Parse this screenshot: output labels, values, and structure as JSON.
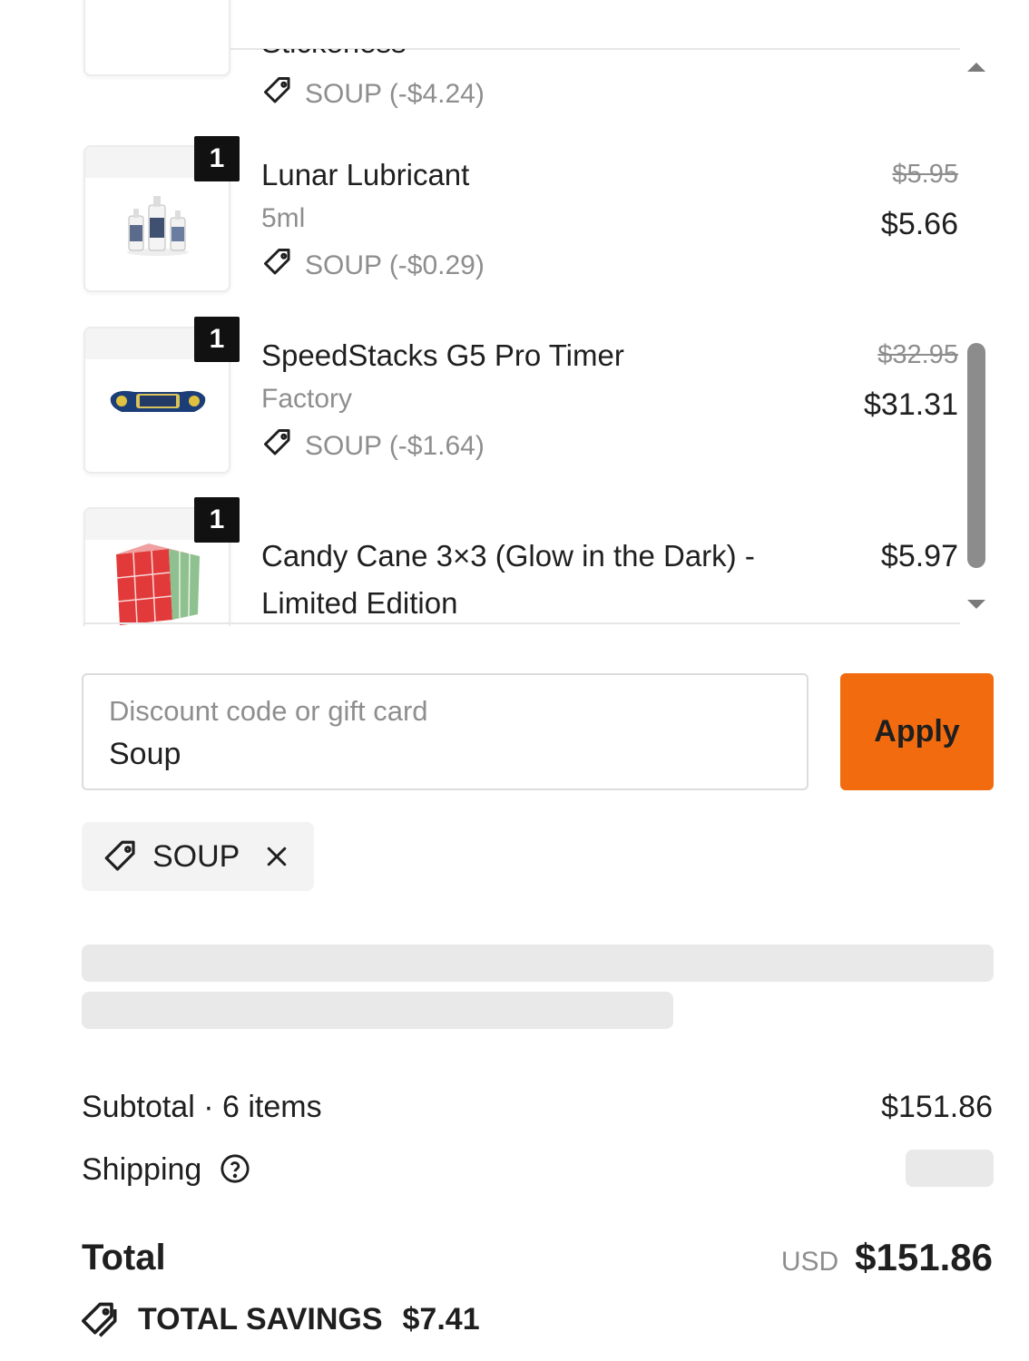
{
  "cart": {
    "items": [
      {
        "name": "Stickerless",
        "discount": "SOUP (-$4.24)"
      },
      {
        "quantity": "1",
        "name": "Lunar Lubricant",
        "variant": "5ml",
        "discount": "SOUP (-$0.29)",
        "original_price": "$5.95",
        "price": "$5.66"
      },
      {
        "quantity": "1",
        "name": "SpeedStacks G5 Pro Timer",
        "variant": "Factory",
        "discount": "SOUP (-$1.64)",
        "original_price": "$32.95",
        "price": "$31.31"
      },
      {
        "quantity": "1",
        "name_line1": "Candy Cane 3×3 (Glow in the Dark) -",
        "name_line2": "Limited Edition",
        "price": "$5.97"
      }
    ]
  },
  "discount": {
    "label": "Discount code or gift card",
    "value": "Soup",
    "apply_label": "Apply",
    "applied_code": "SOUP"
  },
  "summary": {
    "subtotal_label": "Subtotal · 6 items",
    "subtotal_value": "$151.86",
    "shipping_label": "Shipping",
    "total_label": "Total",
    "currency": "USD",
    "total_value": "$151.86",
    "savings_label": "TOTAL SAVINGS",
    "savings_value": "$7.41"
  },
  "colors": {
    "accent": "#f26b0f",
    "muted_text": "#8e8e8e",
    "badge": "#111111",
    "skeleton": "#e9e9e9"
  }
}
